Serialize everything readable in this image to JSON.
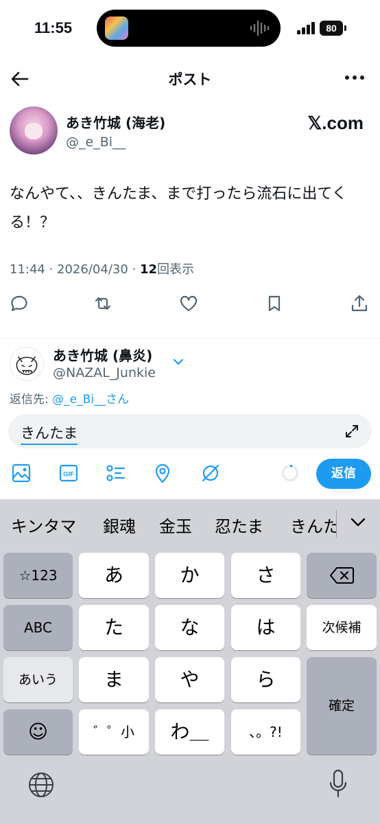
{
  "status_bar": {
    "time": "11:55",
    "battery": "80"
  },
  "header": {
    "title": "ポスト"
  },
  "post": {
    "author_name": "あき竹城 (海老)",
    "author_handle": "@_e_Bi__",
    "source_badge": "𝕏.com",
    "text": "なんやて、、きんたま、まで打ったら流石に出てくる！？",
    "time": "11:44 · 2026/04/30 · ",
    "views_count": "12",
    "views_label": "回表示"
  },
  "composer": {
    "account_name": "あき竹城 (鼻炎)",
    "account_handle": "@NAZAL_Junkie",
    "reply_to_label": "返信先: ",
    "reply_to_handle": "@_e_Bi__さん",
    "input_value": "きんたま",
    "reply_button": "返信"
  },
  "keyboard": {
    "candidates": [
      "キンタマ",
      "銀魂",
      "金玉",
      "忍たま",
      "きんた"
    ],
    "row1": [
      "☆123",
      "あ",
      "か",
      "さ"
    ],
    "row2": [
      "ABC",
      "た",
      "な",
      "は",
      "次候補"
    ],
    "row3": [
      "あいう",
      "ま",
      "や",
      "ら",
      "確定"
    ],
    "row4": [
      "☺",
      "゛゜小",
      "わ＿",
      "、。?!"
    ]
  },
  "colors": {
    "accent": "#1d9bf0",
    "text": "#0f1419",
    "muted": "#536471",
    "keyboard_bg": "#d1d3d9"
  }
}
